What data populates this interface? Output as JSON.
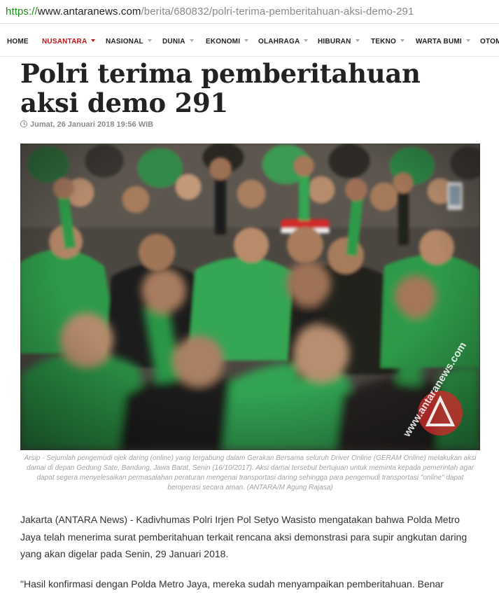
{
  "browser": {
    "url_scheme": "https://",
    "url_host": "www.antaranews.com",
    "url_path": "/berita/680832/polri-terima-pemberitahuan-aksi-demo-291"
  },
  "nav": {
    "items": [
      {
        "label": "HOME"
      },
      {
        "label": "NUSANTARA"
      },
      {
        "label": "NASIONAL"
      },
      {
        "label": "DUNIA"
      },
      {
        "label": "EKONOMI"
      },
      {
        "label": "OLAHRAGA"
      },
      {
        "label": "HIBURAN"
      },
      {
        "label": "TEKNO"
      },
      {
        "label": "WARTA BUMI"
      },
      {
        "label": "OTOM"
      }
    ],
    "active_color": "#c0141b"
  },
  "article": {
    "title": "Polri terima pemberitahuan aksi demo 291",
    "date": "Jumat, 26 Januari 2018 19:56 WIB",
    "watermark": "www.antaranews.com",
    "caption": "Arsip - Sejumlah pengemudi ojek daring (online) yang tergabung dalam Gerakan Bersama seluruh Driver Online (GERAM Online) melakukan aksi damai di depan Gedung Sate, Bandung, Jawa Barat, Senin (16/10/2017). Aksi damai tersebut bertujuan untuk meminta kepada pemerintah agar dapat segera menyelesaikan permasalahan peraturan mengenai transportasi daring sehingga para pengemudi transportasi \"online\" dapat beroperasi secara aman. (ANTARA/M Agung Rajasa)",
    "paragraph1": "Jakarta (ANTARA News) - Kadivhumas Polri Irjen Pol Setyo Wasisto mengatakan bahwa Polda Metro Jaya telah menerima surat pemberitahuan terkait rencana aksi demonstrasi para supir angkutan daring yang akan digelar pada Senin, 29 Januari 2018.",
    "paragraph2": "\"Hasil konfirmasi dengan Polda Metro Jaya, mereka sudah menyampaikan pemberitahuan. Benar"
  },
  "icons": {
    "date_icon": "clock-icon",
    "dropdown_icon": "caret-down-icon",
    "watermark_logo": "antara-logo-icon"
  }
}
